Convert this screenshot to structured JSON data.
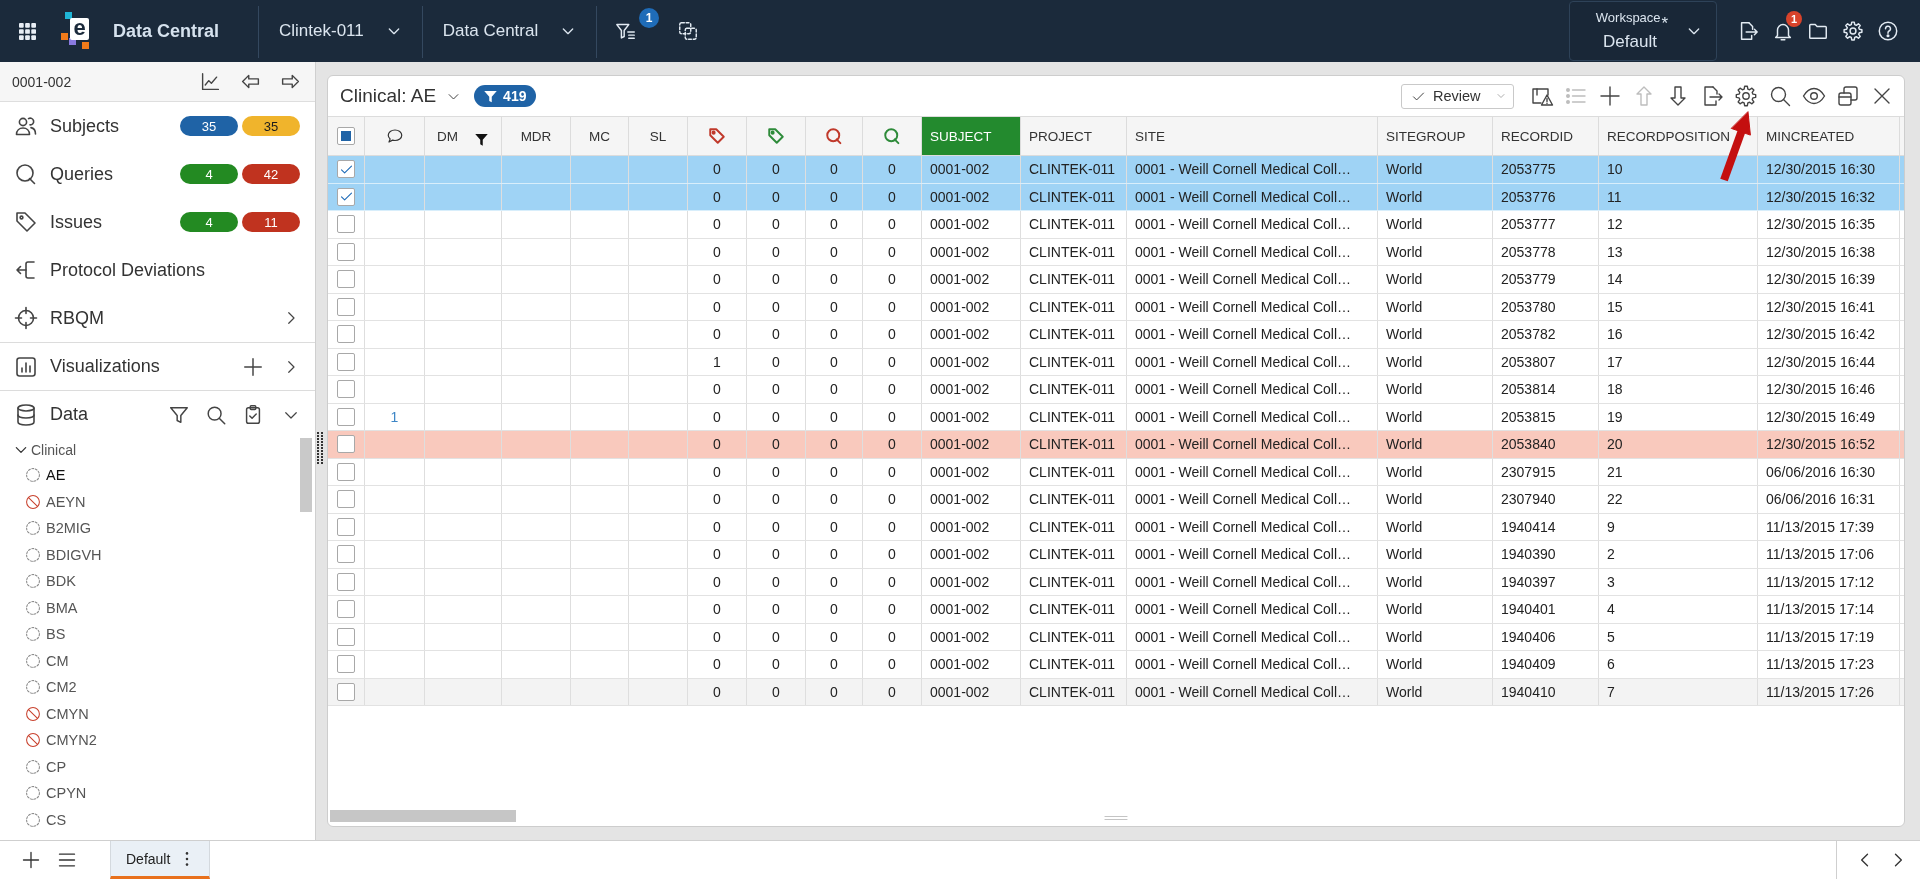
{
  "topbar": {
    "logo_letter": "e",
    "app_title": "Data Central",
    "project": "Clintek-011",
    "module": "Data Central",
    "filter_count": "1",
    "workspace_label": "Workspace",
    "workspace_modified": "*",
    "workspace": "Default",
    "notification_count": "1"
  },
  "sidebar": {
    "subject": "0001-002",
    "nav": [
      {
        "label": "Subjects",
        "expandable": false,
        "badges": [
          {
            "text": "35",
            "color": "#1f63a6"
          },
          {
            "text": "35",
            "color": "#f0b42c"
          }
        ]
      },
      {
        "label": "Queries",
        "expandable": false,
        "badges": [
          {
            "text": "4",
            "color": "#238a22"
          },
          {
            "text": "42",
            "color": "#c0331f"
          }
        ]
      },
      {
        "label": "Issues",
        "expandable": false,
        "badges": [
          {
            "text": "4",
            "color": "#238a22"
          },
          {
            "text": "11",
            "color": "#c0331f"
          }
        ]
      },
      {
        "label": "Protocol Deviations",
        "expandable": false
      },
      {
        "label": "RBQM",
        "expandable": true
      }
    ],
    "visualizations": {
      "label": "Visualizations",
      "expandable": true
    },
    "data": {
      "label": "Data",
      "expanded": true
    },
    "tree": {
      "label": "Clinical",
      "expanded": true,
      "children": [
        {
          "label": "AE",
          "selected": true,
          "blocked": false
        },
        {
          "label": "AEYN",
          "selected": false,
          "blocked": true
        },
        {
          "label": "B2MIG",
          "selected": false,
          "blocked": false
        },
        {
          "label": "BDIGVH",
          "selected": false,
          "blocked": false
        },
        {
          "label": "BDK",
          "selected": false,
          "blocked": false
        },
        {
          "label": "BMA",
          "selected": false,
          "blocked": false
        },
        {
          "label": "BS",
          "selected": false,
          "blocked": false
        },
        {
          "label": "CM",
          "selected": false,
          "blocked": false
        },
        {
          "label": "CM2",
          "selected": false,
          "blocked": false
        },
        {
          "label": "CMYN",
          "selected": false,
          "blocked": true
        },
        {
          "label": "CMYN2",
          "selected": false,
          "blocked": true
        },
        {
          "label": "CP",
          "selected": false,
          "blocked": false
        },
        {
          "label": "CPYN",
          "selected": false,
          "blocked": false
        },
        {
          "label": "CS",
          "selected": false,
          "blocked": false
        }
      ]
    }
  },
  "panel": {
    "title": "Clinical: AE",
    "filter_count": "419",
    "review": "Review",
    "tools": [
      {
        "kind": "alerts",
        "disabled": false,
        "annotated": false
      },
      {
        "kind": "list",
        "disabled": true,
        "annotated": false
      },
      {
        "kind": "add",
        "disabled": false,
        "annotated": false
      },
      {
        "kind": "move-up",
        "disabled": true,
        "annotated": false
      },
      {
        "kind": "move-down",
        "disabled": false,
        "annotated": false
      },
      {
        "kind": "export",
        "disabled": false,
        "annotated": false
      },
      {
        "kind": "settings",
        "disabled": false,
        "annotated": true
      },
      {
        "kind": "search",
        "disabled": false,
        "annotated": false
      },
      {
        "kind": "view",
        "disabled": false,
        "annotated": false
      },
      {
        "kind": "restore",
        "disabled": false,
        "annotated": false
      },
      {
        "kind": "close",
        "disabled": false,
        "annotated": false
      }
    ]
  },
  "table": {
    "select_all": {
      "partial": true
    },
    "columns": [
      {
        "kind": "comments",
        "selected": false,
        "filtered": false
      },
      {
        "kind": "text",
        "label": "DM",
        "selected": false,
        "filtered": true
      },
      {
        "kind": "text",
        "label": "MDR",
        "selected": false,
        "filtered": false
      },
      {
        "kind": "text",
        "label": "MC",
        "selected": false,
        "filtered": false
      },
      {
        "kind": "text",
        "label": "SL",
        "selected": false,
        "filtered": false
      },
      {
        "kind": "tag",
        "color": "#c0392b",
        "selected": false,
        "filtered": false
      },
      {
        "kind": "tag",
        "color": "#2e8b3a",
        "selected": false,
        "filtered": false
      },
      {
        "kind": "query",
        "color": "#c0392b",
        "selected": false,
        "filtered": false
      },
      {
        "kind": "query",
        "color": "#2e8b3a",
        "selected": false,
        "filtered": false
      },
      {
        "kind": "text",
        "label": "SUBJECT",
        "selected": true,
        "filtered": false
      },
      {
        "kind": "text",
        "label": "PROJECT",
        "selected": false,
        "filtered": false
      },
      {
        "kind": "text",
        "label": "SITE",
        "selected": false,
        "filtered": false
      },
      {
        "kind": "text",
        "label": "SITEGROUP",
        "selected": false,
        "filtered": false
      },
      {
        "kind": "text",
        "label": "RECORDID",
        "selected": false,
        "filtered": false
      },
      {
        "kind": "text",
        "label": "RECORDPOSITION",
        "selected": false,
        "filtered": false
      },
      {
        "kind": "text",
        "label": "MINCREATED",
        "selected": false,
        "filtered": false
      }
    ],
    "rows": [
      {
        "selected": true,
        "flagged": false,
        "hovered": false,
        "values": [
          "0",
          "0",
          "0",
          "0",
          "0001-002",
          "CLINTEK-011",
          "0001 - Weill Cornell Medical Coll…",
          "World",
          "2053775",
          "10",
          "12/30/2015 16:30"
        ]
      },
      {
        "selected": true,
        "flagged": false,
        "hovered": false,
        "values": [
          "0",
          "0",
          "0",
          "0",
          "0001-002",
          "CLINTEK-011",
          "0001 - Weill Cornell Medical Coll…",
          "World",
          "2053776",
          "11",
          "12/30/2015 16:32"
        ]
      },
      {
        "selected": false,
        "flagged": false,
        "hovered": false,
        "values": [
          "0",
          "0",
          "0",
          "0",
          "0001-002",
          "CLINTEK-011",
          "0001 - Weill Cornell Medical Coll…",
          "World",
          "2053777",
          "12",
          "12/30/2015 16:35"
        ]
      },
      {
        "selected": false,
        "flagged": false,
        "hovered": false,
        "values": [
          "0",
          "0",
          "0",
          "0",
          "0001-002",
          "CLINTEK-011",
          "0001 - Weill Cornell Medical Coll…",
          "World",
          "2053778",
          "13",
          "12/30/2015 16:38"
        ]
      },
      {
        "selected": false,
        "flagged": false,
        "hovered": false,
        "values": [
          "0",
          "0",
          "0",
          "0",
          "0001-002",
          "CLINTEK-011",
          "0001 - Weill Cornell Medical Coll…",
          "World",
          "2053779",
          "14",
          "12/30/2015 16:39"
        ]
      },
      {
        "selected": false,
        "flagged": false,
        "hovered": false,
        "values": [
          "0",
          "0",
          "0",
          "0",
          "0001-002",
          "CLINTEK-011",
          "0001 - Weill Cornell Medical Coll…",
          "World",
          "2053780",
          "15",
          "12/30/2015 16:41"
        ]
      },
      {
        "selected": false,
        "flagged": false,
        "hovered": false,
        "values": [
          "0",
          "0",
          "0",
          "0",
          "0001-002",
          "CLINTEK-011",
          "0001 - Weill Cornell Medical Coll…",
          "World",
          "2053782",
          "16",
          "12/30/2015 16:42"
        ]
      },
      {
        "selected": false,
        "flagged": false,
        "hovered": false,
        "values": [
          "1",
          "0",
          "0",
          "0",
          "0001-002",
          "CLINTEK-011",
          "0001 - Weill Cornell Medical Coll…",
          "World",
          "2053807",
          "17",
          "12/30/2015 16:44"
        ]
      },
      {
        "selected": false,
        "flagged": false,
        "hovered": false,
        "values": [
          "0",
          "0",
          "0",
          "0",
          "0001-002",
          "CLINTEK-011",
          "0001 - Weill Cornell Medical Coll…",
          "World",
          "2053814",
          "18",
          "12/30/2015 16:46"
        ]
      },
      {
        "selected": false,
        "flagged": false,
        "hovered": false,
        "comments": "1",
        "values": [
          "0",
          "0",
          "0",
          "0",
          "0001-002",
          "CLINTEK-011",
          "0001 - Weill Cornell Medical Coll…",
          "World",
          "2053815",
          "19",
          "12/30/2015 16:49"
        ]
      },
      {
        "selected": false,
        "flagged": true,
        "hovered": false,
        "values": [
          "0",
          "0",
          "0",
          "0",
          "0001-002",
          "CLINTEK-011",
          "0001 - Weill Cornell Medical Coll…",
          "World",
          "2053840",
          "20",
          "12/30/2015 16:52"
        ]
      },
      {
        "selected": false,
        "flagged": false,
        "hovered": false,
        "values": [
          "0",
          "0",
          "0",
          "0",
          "0001-002",
          "CLINTEK-011",
          "0001 - Weill Cornell Medical Coll…",
          "World",
          "2307915",
          "21",
          "06/06/2016 16:30"
        ]
      },
      {
        "selected": false,
        "flagged": false,
        "hovered": false,
        "values": [
          "0",
          "0",
          "0",
          "0",
          "0001-002",
          "CLINTEK-011",
          "0001 - Weill Cornell Medical Coll…",
          "World",
          "2307940",
          "22",
          "06/06/2016 16:31"
        ]
      },
      {
        "selected": false,
        "flagged": false,
        "hovered": false,
        "values": [
          "0",
          "0",
          "0",
          "0",
          "0001-002",
          "CLINTEK-011",
          "0001 - Weill Cornell Medical Coll…",
          "World",
          "1940414",
          "9",
          "11/13/2015 17:39"
        ]
      },
      {
        "selected": false,
        "flagged": false,
        "hovered": false,
        "values": [
          "0",
          "0",
          "0",
          "0",
          "0001-002",
          "CLINTEK-011",
          "0001 - Weill Cornell Medical Coll…",
          "World",
          "1940390",
          "2",
          "11/13/2015 17:06"
        ]
      },
      {
        "selected": false,
        "flagged": false,
        "hovered": false,
        "values": [
          "0",
          "0",
          "0",
          "0",
          "0001-002",
          "CLINTEK-011",
          "0001 - Weill Cornell Medical Coll…",
          "World",
          "1940397",
          "3",
          "11/13/2015 17:12"
        ]
      },
      {
        "selected": false,
        "flagged": false,
        "hovered": false,
        "values": [
          "0",
          "0",
          "0",
          "0",
          "0001-002",
          "CLINTEK-011",
          "0001 - Weill Cornell Medical Coll…",
          "World",
          "1940401",
          "4",
          "11/13/2015 17:14"
        ]
      },
      {
        "selected": false,
        "flagged": false,
        "hovered": false,
        "values": [
          "0",
          "0",
          "0",
          "0",
          "0001-002",
          "CLINTEK-011",
          "0001 - Weill Cornell Medical Coll…",
          "World",
          "1940406",
          "5",
          "11/13/2015 17:19"
        ]
      },
      {
        "selected": false,
        "flagged": false,
        "hovered": false,
        "values": [
          "0",
          "0",
          "0",
          "0",
          "0001-002",
          "CLINTEK-011",
          "0001 - Weill Cornell Medical Coll…",
          "World",
          "1940409",
          "6",
          "11/13/2015 17:23"
        ]
      },
      {
        "selected": false,
        "flagged": false,
        "hovered": true,
        "values": [
          "0",
          "0",
          "0",
          "0",
          "0001-002",
          "CLINTEK-011",
          "0001 - Weill Cornell Medical Coll…",
          "World",
          "1940410",
          "7",
          "11/13/2015 17:26"
        ]
      }
    ]
  },
  "bottom_bar": {
    "tabs": [
      {
        "label": "Default",
        "selected": true
      }
    ]
  }
}
